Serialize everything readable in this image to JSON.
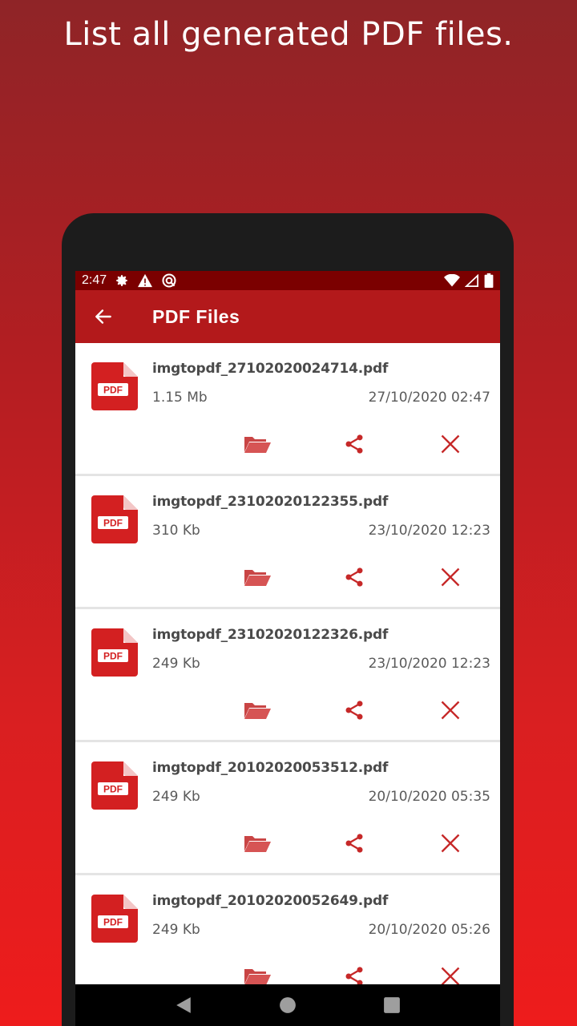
{
  "promo": {
    "caption": "List all generated PDF files."
  },
  "status_bar": {
    "time": "2:47"
  },
  "app_bar": {
    "title": "PDF Files"
  },
  "icon_label": "PDF",
  "colors": {
    "accent": "#b3191b",
    "status": "#7b0000",
    "action": "#c62828"
  },
  "files": [
    {
      "name": "imgtopdf_27102020024714.pdf",
      "size": "1.15 Mb",
      "date": "27/10/2020 02:47"
    },
    {
      "name": "imgtopdf_23102020122355.pdf",
      "size": "310 Kb",
      "date": "23/10/2020 12:23"
    },
    {
      "name": "imgtopdf_23102020122326.pdf",
      "size": "249 Kb",
      "date": "23/10/2020 12:23"
    },
    {
      "name": "imgtopdf_20102020053512.pdf",
      "size": "249 Kb",
      "date": "20/10/2020 05:35"
    },
    {
      "name": "imgtopdf_20102020052649.pdf",
      "size": "249 Kb",
      "date": "20/10/2020 05:26"
    }
  ]
}
